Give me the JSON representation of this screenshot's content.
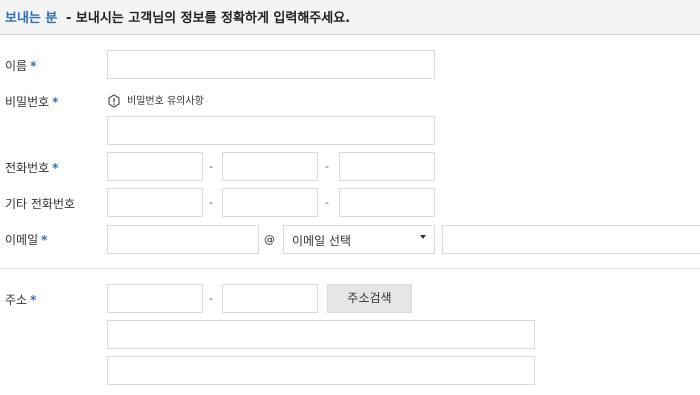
{
  "header": {
    "title": "보내는 분",
    "description": "- 보내시는 고객님의 정보를 정확하게 입력해주세요."
  },
  "form": {
    "name_label": "이름",
    "password_label": "비밀번호",
    "password_note": "비밀번호 유의사항",
    "phone_label": "전화번호",
    "other_phone_label": "기타 전화번호",
    "email_label": "이메일",
    "address_label": "주소",
    "required_mark": "*",
    "dash": "-",
    "at_sign": "@",
    "email_select_value": "이메일 선택",
    "address_search_button": "주소검색"
  },
  "icons": {
    "note_icon": "exclamation-hexagon-icon",
    "select_caret": "caret-down-icon"
  },
  "colors": {
    "accent": "#2f6fb5",
    "header_bg": "#f4f4f4",
    "border": "#d9d9d9",
    "button_bg": "#e6e6e6"
  }
}
